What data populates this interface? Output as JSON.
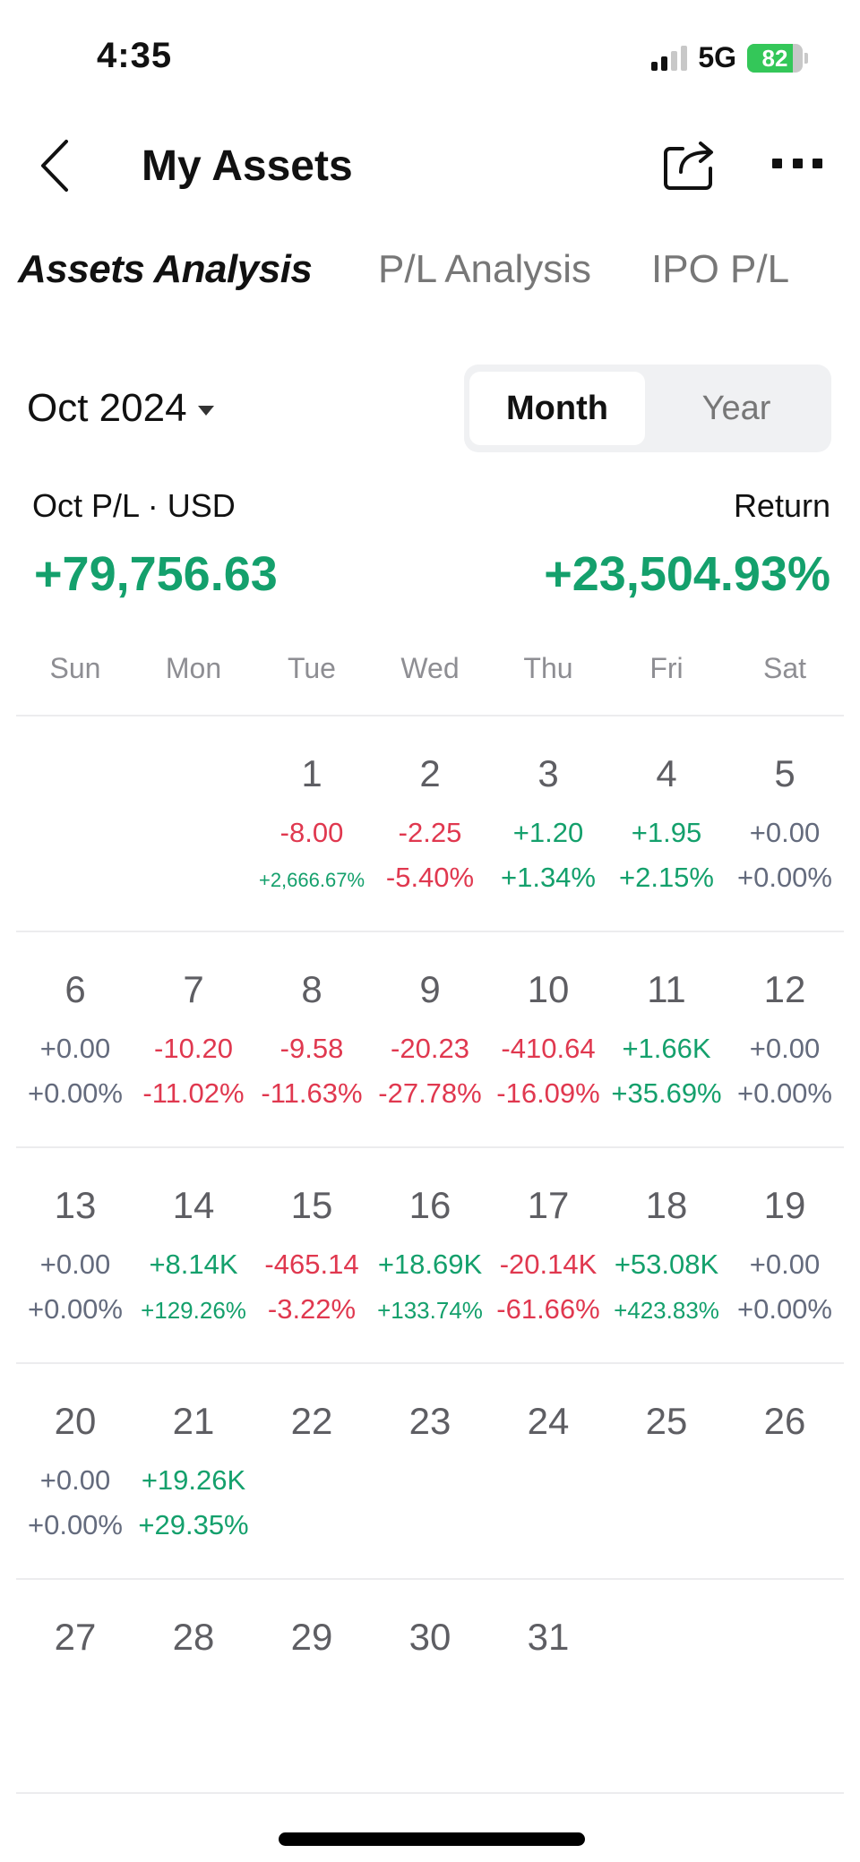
{
  "status_bar": {
    "time": "4:35",
    "network": "5G",
    "battery_percent": 82,
    "battery_label": "82",
    "signal_bars_on": 2,
    "signal_bars_total": 4
  },
  "header": {
    "title": "My Assets",
    "back_icon": "chevron-left-icon",
    "share_icon": "share-icon",
    "more_icon": "ellipsis-icon"
  },
  "tabs": [
    {
      "label": "Assets Analysis",
      "active": true
    },
    {
      "label": "P/L Analysis",
      "active": false
    },
    {
      "label": "IPO P/L",
      "active": false
    }
  ],
  "period": {
    "selected": "Oct 2024",
    "segments": [
      {
        "label": "Month",
        "active": true
      },
      {
        "label": "Year",
        "active": false
      }
    ]
  },
  "summary": {
    "pl_label": "Oct P/L · USD",
    "pl_value": "+79,756.63",
    "return_label": "Return",
    "return_value": "+23,504.93%"
  },
  "colors": {
    "positive": "#14a06c",
    "negative": "#e0384f",
    "neutral": "#646b7d",
    "accent": "#f07a22"
  },
  "calendar": {
    "weekdays": [
      "Sun",
      "Mon",
      "Tue",
      "Wed",
      "Thu",
      "Fri",
      "Sat"
    ],
    "weeks": [
      [
        {
          "day": "",
          "pl": "",
          "pct": "",
          "tone": ""
        },
        {
          "day": "",
          "pl": "",
          "pct": "",
          "tone": ""
        },
        {
          "day": "1",
          "pl": "-8.00",
          "pct": "+2,666.67%",
          "pl_tone": "neg",
          "pct_tone": "pos",
          "small": true
        },
        {
          "day": "2",
          "pl": "-2.25",
          "pct": "-5.40%",
          "pl_tone": "neg",
          "pct_tone": "neg"
        },
        {
          "day": "3",
          "pl": "+1.20",
          "pct": "+1.34%",
          "pl_tone": "pos",
          "pct_tone": "pos"
        },
        {
          "day": "4",
          "pl": "+1.95",
          "pct": "+2.15%",
          "pl_tone": "pos",
          "pct_tone": "pos"
        },
        {
          "day": "5",
          "pl": "+0.00",
          "pct": "+0.00%",
          "pl_tone": "zero",
          "pct_tone": "zero"
        }
      ],
      [
        {
          "day": "6",
          "pl": "+0.00",
          "pct": "+0.00%",
          "pl_tone": "zero",
          "pct_tone": "zero"
        },
        {
          "day": "7",
          "pl": "-10.20",
          "pct": "-11.02%",
          "pl_tone": "neg",
          "pct_tone": "neg"
        },
        {
          "day": "8",
          "pl": "-9.58",
          "pct": "-11.63%",
          "pl_tone": "neg",
          "pct_tone": "neg"
        },
        {
          "day": "9",
          "pl": "-20.23",
          "pct": "-27.78%",
          "pl_tone": "neg",
          "pct_tone": "neg"
        },
        {
          "day": "10",
          "pl": "-410.64",
          "pct": "-16.09%",
          "pl_tone": "neg",
          "pct_tone": "neg"
        },
        {
          "day": "11",
          "pl": "+1.66K",
          "pct": "+35.69%",
          "pl_tone": "pos",
          "pct_tone": "pos"
        },
        {
          "day": "12",
          "pl": "+0.00",
          "pct": "+0.00%",
          "pl_tone": "zero",
          "pct_tone": "zero"
        }
      ],
      [
        {
          "day": "13",
          "pl": "+0.00",
          "pct": "+0.00%",
          "pl_tone": "zero",
          "pct_tone": "zero"
        },
        {
          "day": "14",
          "pl": "+8.14K",
          "pct": "+129.26%",
          "pl_tone": "pos",
          "pct_tone": "pos",
          "medium": true
        },
        {
          "day": "15",
          "pl": "-465.14",
          "pct": "-3.22%",
          "pl_tone": "neg",
          "pct_tone": "neg"
        },
        {
          "day": "16",
          "pl": "+18.69K",
          "pct": "+133.74%",
          "pl_tone": "pos",
          "pct_tone": "pos",
          "medium": true
        },
        {
          "day": "17",
          "pl": "-20.14K",
          "pct": "-61.66%",
          "pl_tone": "neg",
          "pct_tone": "neg"
        },
        {
          "day": "18",
          "pl": "+53.08K",
          "pct": "+423.83%",
          "pl_tone": "pos",
          "pct_tone": "pos",
          "medium": true
        },
        {
          "day": "19",
          "pl": "+0.00",
          "pct": "+0.00%",
          "pl_tone": "zero",
          "pct_tone": "zero"
        }
      ],
      [
        {
          "day": "20",
          "pl": "+0.00",
          "pct": "+0.00%",
          "pl_tone": "zero",
          "pct_tone": "zero"
        },
        {
          "day": "21",
          "pl": "+19.26K",
          "pct": "+29.35%",
          "pl_tone": "pos",
          "pct_tone": "pos"
        },
        {
          "day": "22",
          "pl": "",
          "pct": ""
        },
        {
          "day": "23",
          "pl": "",
          "pct": ""
        },
        {
          "day": "24",
          "pl": "",
          "pct": ""
        },
        {
          "day": "25",
          "pl": "",
          "pct": ""
        },
        {
          "day": "26",
          "pl": "",
          "pct": ""
        }
      ],
      [
        {
          "day": "27",
          "pl": "",
          "pct": ""
        },
        {
          "day": "28",
          "pl": "",
          "pct": ""
        },
        {
          "day": "29",
          "pl": "",
          "pct": ""
        },
        {
          "day": "30",
          "pl": "",
          "pct": ""
        },
        {
          "day": "31",
          "pl": "",
          "pct": ""
        },
        {
          "day": "",
          "pl": "",
          "pct": ""
        },
        {
          "day": "",
          "pl": "",
          "pct": ""
        }
      ]
    ]
  }
}
